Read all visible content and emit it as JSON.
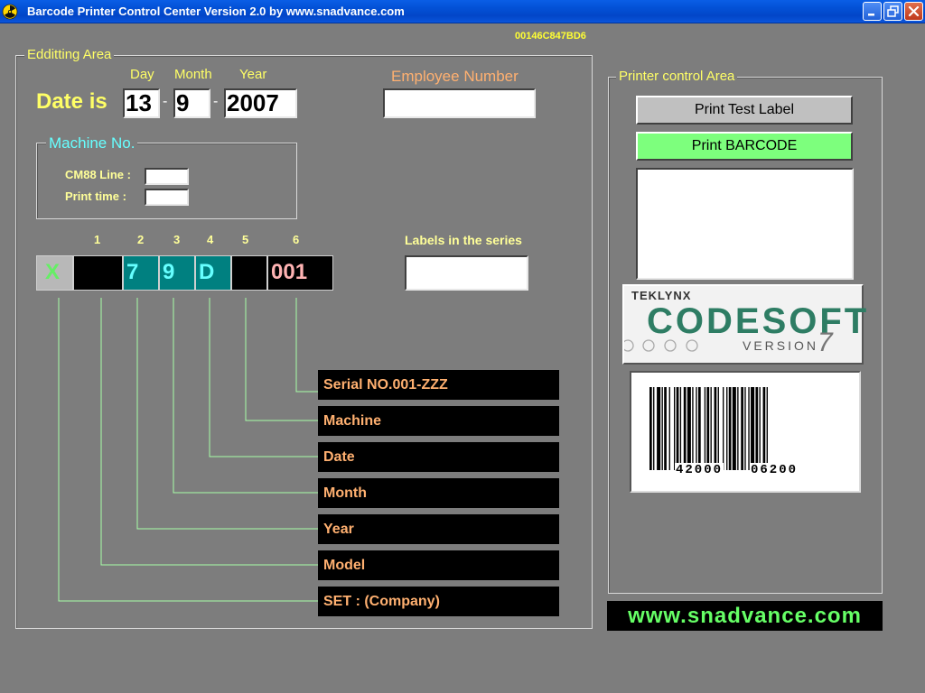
{
  "window": {
    "title": "Barcode Printer Control Center Version 2.0  by www.snadvance.com"
  },
  "serial_code": "00146C847BD6",
  "editing_area": {
    "legend": "Edditting Area",
    "date_label": "Date is",
    "day_header": "Day",
    "month_header": "Month",
    "year_header": "Year",
    "day_value": "13",
    "month_value": "9",
    "year_value": "2007",
    "date_separator": "-",
    "employee_number_label": "Employee Number",
    "employee_number_value": "",
    "machine": {
      "legend": "Machine No.",
      "cm88_line_label": "CM88 Line :",
      "cm88_line_value": "",
      "print_time_label": "Print time   :",
      "print_time_value": ""
    },
    "code_positions": [
      "1",
      "2",
      "3",
      "4",
      "5",
      "6"
    ],
    "code_cells": [
      "X",
      "",
      "7",
      "9",
      "D",
      "",
      "001"
    ],
    "labels_in_series_label": "Labels in the series",
    "labels_in_series_value": "",
    "legend_items": [
      "Serial NO.001-ZZZ",
      "Machine",
      "Date",
      "Month",
      "Year",
      "Model",
      "SET : (Company)"
    ]
  },
  "printer_area": {
    "legend": "Printer control Area",
    "print_test_label": "Print Test Label",
    "print_barcode": "Print  BARCODE",
    "output_text": "",
    "logo": {
      "brand": "TEKLYNX",
      "product": "CODESOFT",
      "version_label": "VERSION",
      "version_number": "7"
    },
    "barcode_number_left": "42000",
    "barcode_number_right": "06200"
  },
  "website": "www.snadvance.com",
  "colors": {
    "background": "#7d7d7d",
    "title_bar": "#0351d6",
    "yellow_text": "#ffff66",
    "orange_text": "#ffb070",
    "cyan_text": "#66ffff",
    "green_button": "#7dff7d",
    "teal_cell": "#008080",
    "website_text": "#66ff66"
  },
  "icons": [
    "radiation-icon",
    "minimize-icon",
    "restore-icon",
    "close-icon"
  ]
}
